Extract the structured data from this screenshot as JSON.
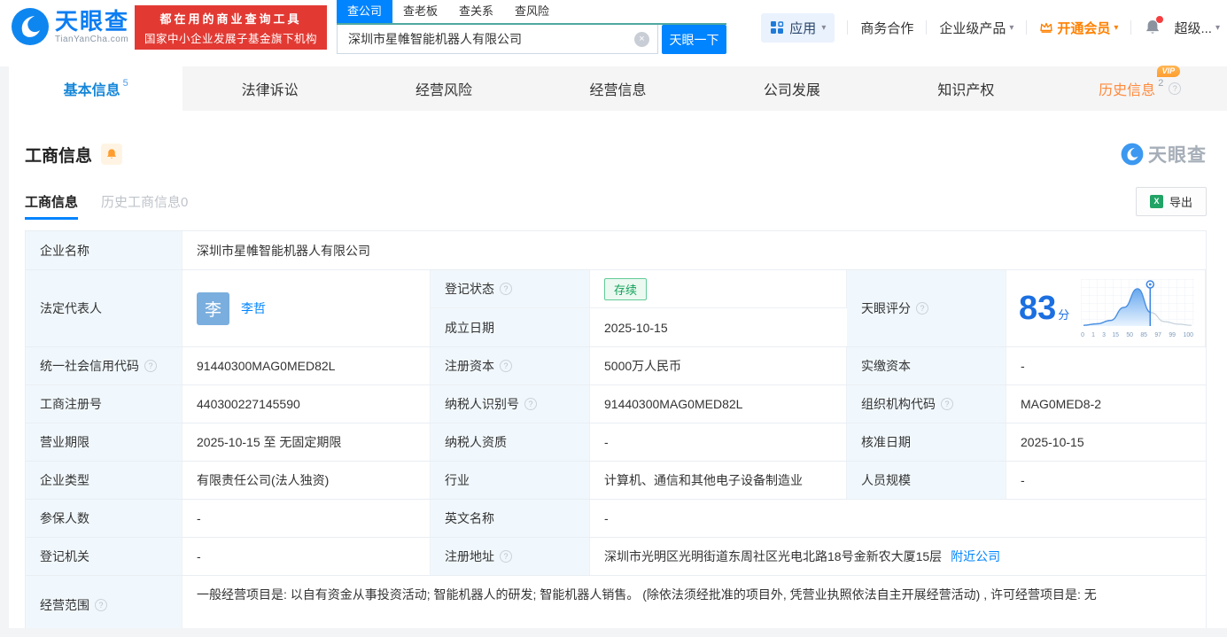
{
  "colors": {
    "accent_blue": "#0084ff",
    "banner_red": "#e23a33",
    "vip_orange": "#ff8000",
    "status_green": "#12a159",
    "score_blue": "#1b6fe0",
    "label_cell_bg": "#f1f8fd"
  },
  "icons": {
    "help_glyph": "?",
    "clear_glyph": "×",
    "caret_glyph": "▾",
    "excel_glyph": "X"
  },
  "header": {
    "logo": {
      "brand": "天眼查",
      "domain": "TianYanCha.com"
    },
    "banner": {
      "line1": "都在用的商业查询工具",
      "line2": "国家中小企业发展子基金旗下机构"
    },
    "search": {
      "tabs": [
        {
          "label": "查公司",
          "active": true
        },
        {
          "label": "查老板",
          "active": false
        },
        {
          "label": "查关系",
          "active": false
        },
        {
          "label": "查风险",
          "active": false
        }
      ],
      "value": "深圳市星帷智能机器人有限公司",
      "button": "天眼一下"
    },
    "nav": {
      "apps": "应用",
      "cooperation": "商务合作",
      "enterprise": "企业级产品",
      "vip": "开通会员",
      "more": "超级..."
    }
  },
  "tabs": [
    {
      "label": "基本信息",
      "badge": "5"
    },
    {
      "label": "法律诉讼"
    },
    {
      "label": "经营风险"
    },
    {
      "label": "经营信息"
    },
    {
      "label": "公司发展"
    },
    {
      "label": "知识产权"
    },
    {
      "label": "历史信息",
      "badge": "2",
      "vip": "VIP"
    }
  ],
  "section": {
    "title": "工商信息",
    "watermark": "天眼查",
    "subtabs": [
      {
        "label": "工商信息",
        "active": true
      },
      {
        "label": "历史工商信息0",
        "active": false
      }
    ],
    "export_label": "导出"
  },
  "table": {
    "company_name": {
      "label": "企业名称",
      "value": "深圳市星帷智能机器人有限公司"
    },
    "legal_rep": {
      "label": "法定代表人",
      "avatar": "李",
      "name": "李哲"
    },
    "reg_status": {
      "label": "登记状态",
      "value": "存续"
    },
    "establish_date": {
      "label": "成立日期",
      "value": "2025-10-15"
    },
    "tianyan_score": {
      "label": "天眼评分"
    },
    "credit_code": {
      "label": "统一社会信用代码",
      "value": "91440300MAG0MED82L"
    },
    "reg_capital": {
      "label": "注册资本",
      "value": "5000万人民币"
    },
    "paid_capital": {
      "label": "实缴资本",
      "value": "-"
    },
    "reg_number": {
      "label": "工商注册号",
      "value": "440300227145590"
    },
    "taxpayer_id": {
      "label": "纳税人识别号",
      "value": "91440300MAG0MED82L"
    },
    "org_code": {
      "label": "组织机构代码",
      "value": "MAG0MED8-2"
    },
    "business_term": {
      "label": "营业期限",
      "value": "2025-10-15 至 无固定期限"
    },
    "taxpayer_quality": {
      "label": "纳税人资质",
      "value": "-"
    },
    "approve_date": {
      "label": "核准日期",
      "value": "2025-10-15"
    },
    "company_type": {
      "label": "企业类型",
      "value": "有限责任公司(法人独资)"
    },
    "industry": {
      "label": "行业",
      "value": "计算机、通信和其他电子设备制造业"
    },
    "staff_size": {
      "label": "人员规模",
      "value": "-"
    },
    "insured_count": {
      "label": "参保人数",
      "value": "-"
    },
    "english_name": {
      "label": "英文名称",
      "value": "-"
    },
    "reg_authority": {
      "label": "登记机关",
      "value": "-"
    },
    "reg_address": {
      "label": "注册地址",
      "value": "深圳市光明区光明街道东周社区光电北路18号金新农大厦15层",
      "link": "附近公司"
    },
    "business_scope": {
      "label": "经营范围",
      "value": "一般经营项目是: 以自有资金从事投资活动; 智能机器人的研发; 智能机器人销售。 (除依法须经批准的项目外, 凭营业执照依法自主开展经营活动) , 许可经营项目是: 无"
    }
  },
  "chart_data": {
    "type": "area",
    "title": "天眼评分",
    "score": 83,
    "score_unit": "分",
    "x_ticks": [
      "0",
      "1",
      "3",
      "15",
      "50",
      "85",
      "97",
      "99",
      "100"
    ],
    "values": [
      2,
      6,
      15,
      50,
      100,
      36,
      12,
      5,
      2
    ],
    "marker_index": 4.94,
    "xlabel": "",
    "ylabel": "",
    "legend": false
  }
}
